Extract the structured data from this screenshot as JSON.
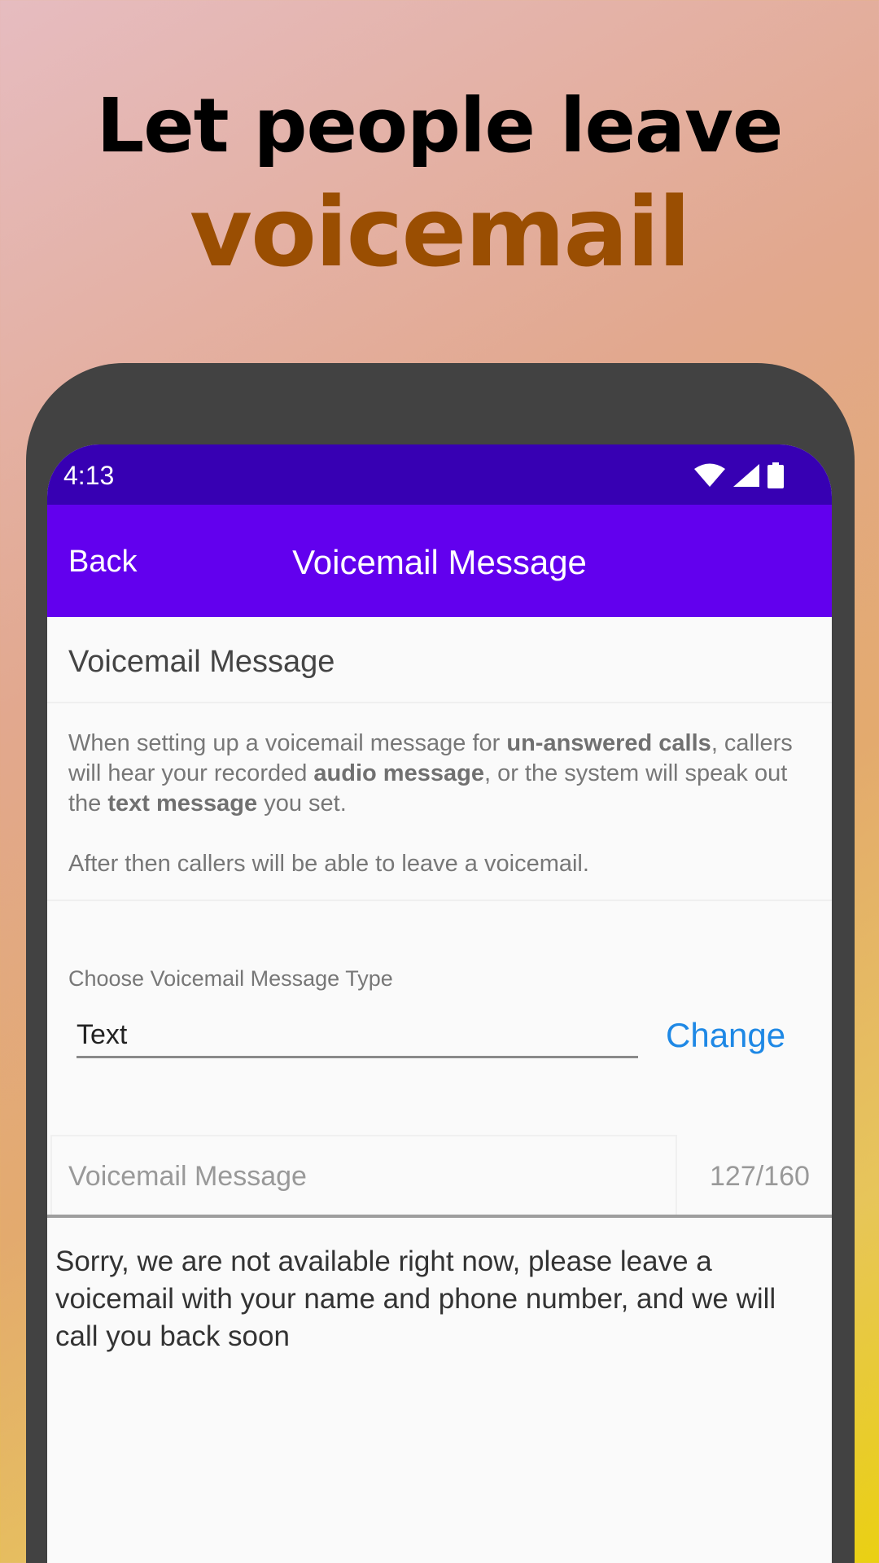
{
  "promo": {
    "headline": "Let people leave",
    "headline_accent": "voicemail"
  },
  "status_bar": {
    "time": "4:13",
    "icons": [
      "wifi-icon",
      "signal-icon",
      "battery-icon"
    ]
  },
  "app_bar": {
    "back_label": "Back",
    "title": "Voicemail Message"
  },
  "section": {
    "title": "Voicemail Message"
  },
  "description": {
    "t1": "When setting up a voicemail message for ",
    "b1": "un-answered calls",
    "t2": ", callers will hear your recorded ",
    "b2": "audio message",
    "t3": ", or the system will speak out the ",
    "b3": "text message",
    "t4": " you set.",
    "paragraph2": "After then callers will be able to leave a voicemail."
  },
  "type_picker": {
    "label": "Choose Voicemail Message Type",
    "value": "Text",
    "change_label": "Change"
  },
  "message_field": {
    "label": "Voicemail Message",
    "count": "127/160",
    "value": "Sorry, we are not available right now, please leave a voicemail with your name and phone number, and we will call you back soon"
  },
  "colors": {
    "status_bar": "#3700b3",
    "app_bar": "#6200ee",
    "accent_link": "#1e88e5",
    "headline_accent": "#9a4e02"
  }
}
